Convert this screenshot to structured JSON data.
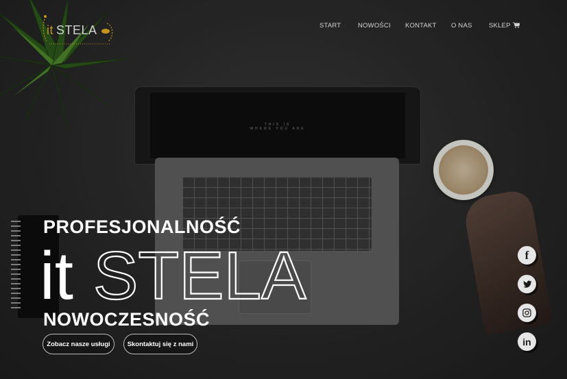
{
  "brand": {
    "logo_it": "it",
    "logo_name": "STELA"
  },
  "nav": {
    "items": [
      "START",
      "NOWOŚCI",
      "KONTAKT",
      "O NAS",
      "SKLEP"
    ],
    "cart_icon": "cart-icon"
  },
  "laptop_screen": {
    "line1": "THIS IS",
    "line2": "WHERE YOU ARE"
  },
  "hero": {
    "line1": "PROFESJONALNOŚĆ",
    "big_it": "it",
    "big_name": "STELA",
    "line3": "NOWOCZESNOŚĆ"
  },
  "buttons": {
    "services": "Zobacz nasze usługi",
    "contact": "Skontaktuj się z nami"
  },
  "social": {
    "facebook": "f",
    "twitter": "twitter-icon",
    "instagram": "instagram-icon",
    "linkedin": "in"
  },
  "colors": {
    "accent": "#f2b424",
    "background": "#2c2c2c"
  }
}
